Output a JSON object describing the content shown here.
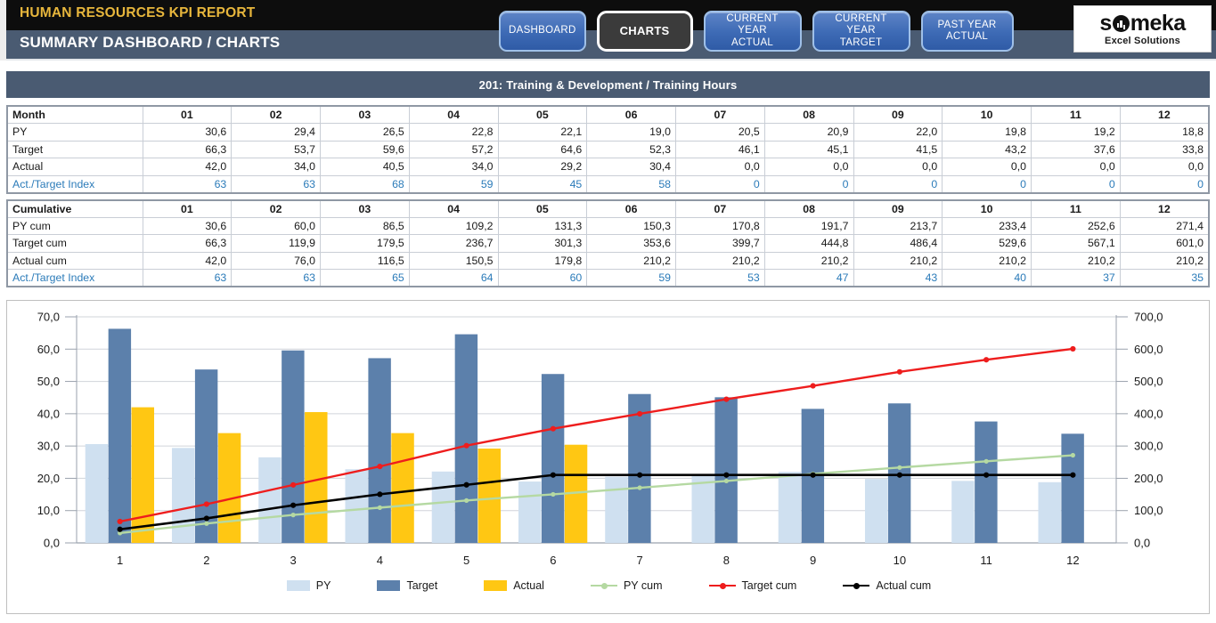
{
  "header": {
    "kpi_title": "HUMAN RESOURCES KPI REPORT",
    "page_title": "SUMMARY DASHBOARD / CHARTS",
    "logo": {
      "word_pre": "s",
      "word_post": "meka",
      "tagline": "Excel Solutions"
    },
    "nav": [
      {
        "name": "dashboard",
        "line1": "DASHBOARD",
        "line2": "",
        "active": false
      },
      {
        "name": "charts",
        "line1": "CHARTS",
        "line2": "",
        "active": true
      },
      {
        "name": "current-year-actual",
        "line1": "CURRENT YEAR",
        "line2": "ACTUAL",
        "active": false
      },
      {
        "name": "current-year-target",
        "line1": "CURRENT YEAR",
        "line2": "TARGET",
        "active": false
      },
      {
        "name": "past-year-actual",
        "line1": "PAST YEAR",
        "line2": "ACTUAL",
        "active": false
      }
    ]
  },
  "section": {
    "title": "201: Training & Development / Training Hours"
  },
  "tables": {
    "monthly": {
      "corner_label": "Month",
      "columns": [
        "01",
        "02",
        "03",
        "04",
        "05",
        "06",
        "07",
        "08",
        "09",
        "10",
        "11",
        "12"
      ],
      "rows": [
        {
          "label": "PY",
          "values": [
            "30,6",
            "29,4",
            "26,5",
            "22,8",
            "22,1",
            "19,0",
            "20,5",
            "20,9",
            "22,0",
            "19,8",
            "19,2",
            "18,8"
          ],
          "index": false
        },
        {
          "label": "Target",
          "values": [
            "66,3",
            "53,7",
            "59,6",
            "57,2",
            "64,6",
            "52,3",
            "46,1",
            "45,1",
            "41,5",
            "43,2",
            "37,6",
            "33,8"
          ],
          "index": false
        },
        {
          "label": "Actual",
          "values": [
            "42,0",
            "34,0",
            "40,5",
            "34,0",
            "29,2",
            "30,4",
            "0,0",
            "0,0",
            "0,0",
            "0,0",
            "0,0",
            "0,0"
          ],
          "index": false
        },
        {
          "label": "Act./Target Index",
          "values": [
            "63",
            "63",
            "68",
            "59",
            "45",
            "58",
            "0",
            "0",
            "0",
            "0",
            "0",
            "0"
          ],
          "index": true
        }
      ]
    },
    "cumulative": {
      "corner_label": "Cumulative",
      "columns": [
        "01",
        "02",
        "03",
        "04",
        "05",
        "06",
        "07",
        "08",
        "09",
        "10",
        "11",
        "12"
      ],
      "rows": [
        {
          "label": "PY cum",
          "values": [
            "30,6",
            "60,0",
            "86,5",
            "109,2",
            "131,3",
            "150,3",
            "170,8",
            "191,7",
            "213,7",
            "233,4",
            "252,6",
            "271,4"
          ],
          "index": false
        },
        {
          "label": "Target cum",
          "values": [
            "66,3",
            "119,9",
            "179,5",
            "236,7",
            "301,3",
            "353,6",
            "399,7",
            "444,8",
            "486,4",
            "529,6",
            "567,1",
            "601,0"
          ],
          "index": false
        },
        {
          "label": "Actual cum",
          "values": [
            "42,0",
            "76,0",
            "116,5",
            "150,5",
            "179,8",
            "210,2",
            "210,2",
            "210,2",
            "210,2",
            "210,2",
            "210,2",
            "210,2"
          ],
          "index": false
        },
        {
          "label": "Act./Target Index",
          "values": [
            "63",
            "63",
            "65",
            "64",
            "60",
            "59",
            "53",
            "47",
            "43",
            "40",
            "37",
            "35"
          ],
          "index": true
        }
      ]
    }
  },
  "chart_data": {
    "type": "bar",
    "title": "201: Training & Development / Training Hours",
    "xlabel": "",
    "ylabel": "",
    "categories": [
      "1",
      "2",
      "3",
      "4",
      "5",
      "6",
      "7",
      "8",
      "9",
      "10",
      "11",
      "12"
    ],
    "x_tick_labels": [
      "1",
      "2",
      "3",
      "4",
      "5",
      "6",
      "7",
      "8",
      "9",
      "10",
      "11",
      "12"
    ],
    "y_left_ticks": [
      "0,0",
      "10,0",
      "20,0",
      "30,0",
      "40,0",
      "50,0",
      "60,0",
      "70,0"
    ],
    "y_right_ticks": [
      "0,0",
      "100,0",
      "200,0",
      "300,0",
      "400,0",
      "500,0",
      "600,0",
      "700,0"
    ],
    "ylim": [
      0,
      70
    ],
    "y2lim": [
      0,
      700
    ],
    "grid": true,
    "legend_position": "bottom",
    "series": [
      {
        "name": "PY",
        "kind": "bar",
        "axis": "left",
        "color": "#cfe0f0",
        "values": [
          30.6,
          29.4,
          26.5,
          22.8,
          22.1,
          19.0,
          20.5,
          20.9,
          22.0,
          19.8,
          19.2,
          18.8
        ]
      },
      {
        "name": "Target",
        "kind": "bar",
        "axis": "left",
        "color": "#5c80ab",
        "values": [
          66.3,
          53.7,
          59.6,
          57.2,
          64.6,
          52.3,
          46.1,
          45.1,
          41.5,
          43.2,
          37.6,
          33.8
        ]
      },
      {
        "name": "Actual",
        "kind": "bar",
        "axis": "left",
        "color": "#ffc713",
        "values": [
          42.0,
          34.0,
          40.5,
          34.0,
          29.2,
          30.4,
          0.0,
          0.0,
          0.0,
          0.0,
          0.0,
          0.0
        ]
      },
      {
        "name": "PY cum",
        "kind": "line",
        "axis": "right",
        "color": "#b5d9a2",
        "values": [
          30.6,
          60.0,
          86.5,
          109.2,
          131.3,
          150.3,
          170.8,
          191.7,
          213.7,
          233.4,
          252.6,
          271.4
        ]
      },
      {
        "name": "Target cum",
        "kind": "line",
        "axis": "right",
        "color": "#ee1d1d",
        "values": [
          66.3,
          119.9,
          179.5,
          236.7,
          301.3,
          353.6,
          399.7,
          444.8,
          486.4,
          529.6,
          567.1,
          601.0
        ]
      },
      {
        "name": "Actual cum",
        "kind": "line",
        "axis": "right",
        "color": "#000000",
        "values": [
          42.0,
          76.0,
          116.5,
          150.5,
          179.8,
          210.2,
          210.2,
          210.2,
          210.2,
          210.2,
          210.2,
          210.2
        ]
      }
    ]
  }
}
